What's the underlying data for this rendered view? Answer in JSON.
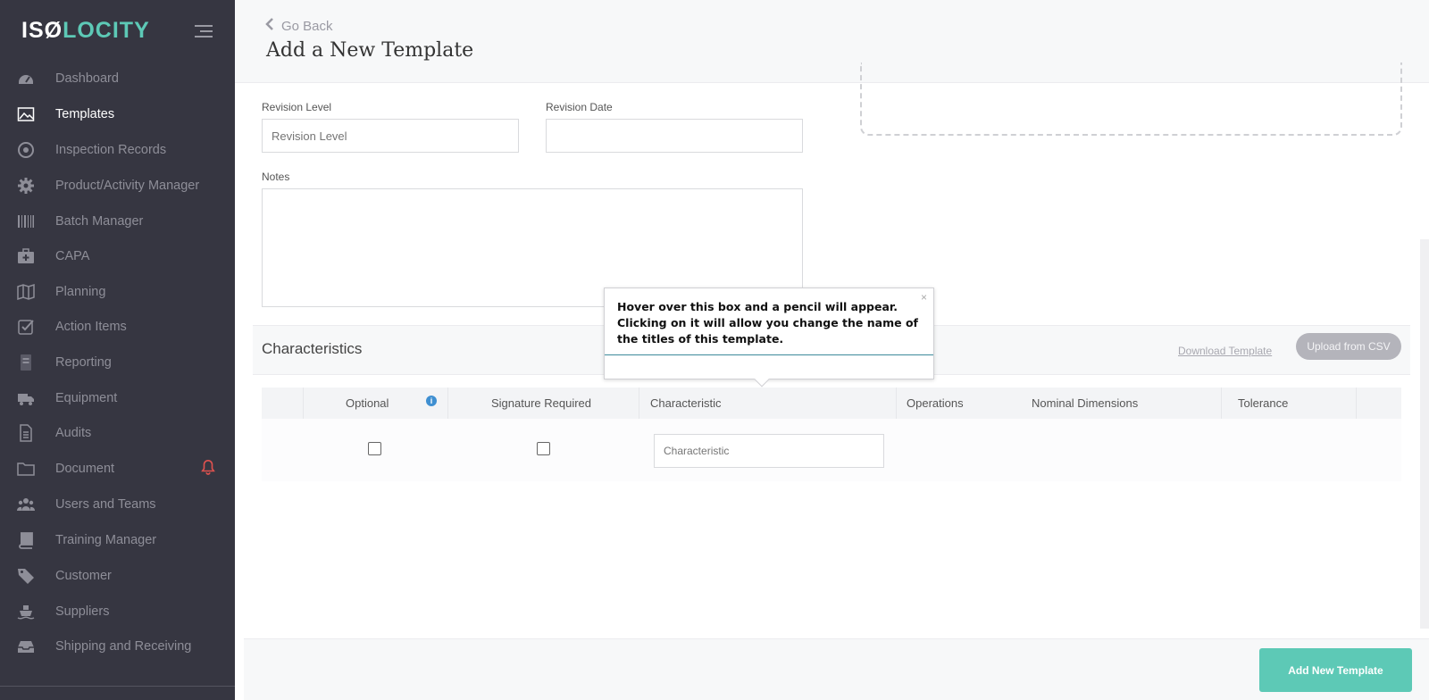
{
  "brand": {
    "logo_part1": "ISØ",
    "logo_part2": "LOCITY"
  },
  "sidebar": {
    "items": [
      {
        "label": "Dashboard",
        "icon": "dashboard-icon"
      },
      {
        "label": "Templates",
        "icon": "image-icon",
        "active": true
      },
      {
        "label": "Inspection Records",
        "icon": "target-icon"
      },
      {
        "label": "Product/Activity Manager",
        "icon": "gear-icon"
      },
      {
        "label": "Batch Manager",
        "icon": "barcode-icon"
      },
      {
        "label": "CAPA",
        "icon": "medkit-icon"
      },
      {
        "label": "Planning",
        "icon": "map-icon"
      },
      {
        "label": "Action Items",
        "icon": "checkbox-icon"
      },
      {
        "label": "Reporting",
        "icon": "report-icon"
      },
      {
        "label": "Equipment",
        "icon": "truck-icon"
      },
      {
        "label": "Audits",
        "icon": "file-icon"
      },
      {
        "label": "Document",
        "icon": "folder-icon",
        "alert": "bell-icon"
      },
      {
        "label": "Users and Teams",
        "icon": "users-icon"
      },
      {
        "label": "Training Manager",
        "icon": "book-icon"
      },
      {
        "label": "Customer",
        "icon": "tag-icon"
      },
      {
        "label": "Suppliers",
        "icon": "ship-icon"
      },
      {
        "label": "Shipping and Receiving",
        "icon": "inbox-icon"
      }
    ]
  },
  "header": {
    "go_back": "Go Back",
    "title": "Add a New Template"
  },
  "form": {
    "revision_level_label": "Revision Level",
    "revision_level_placeholder": "Revision Level",
    "revision_date_label": "Revision Date",
    "notes_label": "Notes"
  },
  "characteristics": {
    "title": "Characteristics",
    "download_link": "Download Template",
    "upload_button": "Upload from CSV",
    "columns": [
      "Optional",
      "Signature Required",
      "Characteristic",
      "Operations",
      "Nominal Dimensions",
      "Tolerance"
    ],
    "row_placeholder": "Characteristic"
  },
  "tooltip": {
    "text": "Hover over this box and a pencil will appear. Clicking on it will allow you change the name of the titles of this template.",
    "close": "×"
  },
  "footer": {
    "add_button": "Add New Template"
  },
  "colors": {
    "sidebar_bg": "#363641",
    "accent": "#5dc9b6",
    "alert": "#e0524f"
  }
}
